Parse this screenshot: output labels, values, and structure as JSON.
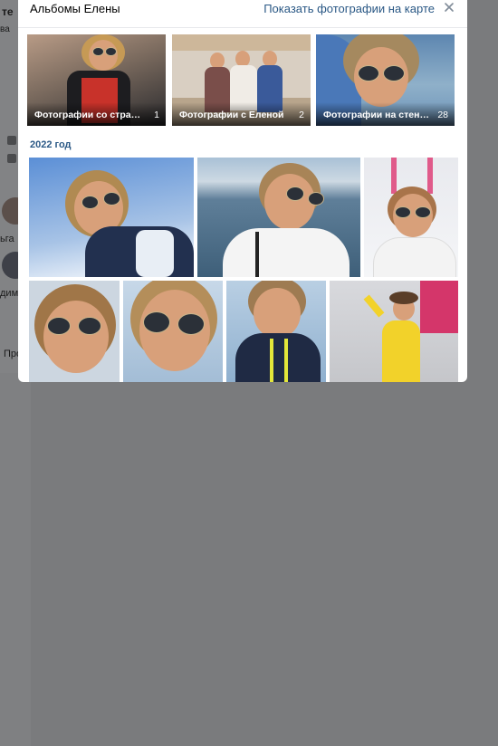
{
  "modal": {
    "title": "Альбомы Елены",
    "map_link": "Показать фотографии на карте"
  },
  "albums": [
    {
      "title": "Фотографии со страницы...",
      "count": "1"
    },
    {
      "title": "Фотографии с Еленой",
      "count": "2"
    },
    {
      "title": "Фотографии на стене Ел...",
      "count": "28"
    }
  ],
  "section": {
    "year": "2022 год"
  },
  "background": {
    "left_text_top": "те",
    "left_text_2": "ва",
    "right_text_1": "ьга",
    "right_text_2": "дим...",
    "right_text_3": "Про иза"
  },
  "icons": {
    "close": "close-icon"
  },
  "colors": {
    "link": "#2a5885",
    "overlay": "#7a7b7d"
  }
}
